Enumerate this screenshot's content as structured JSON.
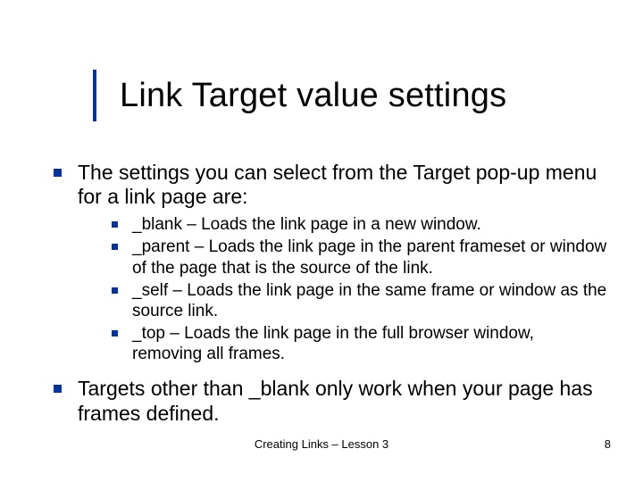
{
  "title": "Link Target value settings",
  "bullets": [
    {
      "text": "The settings you can select from the Target pop-up menu for a link page are:",
      "sub": [
        "_blank – Loads the link page in a new window.",
        "_parent – Loads the link page in the parent frameset or window of the page that is the source of the link.",
        "_self – Loads the link page in the same frame or window as the source link.",
        "_top – Loads the link page in the full browser window, removing all frames."
      ]
    },
    {
      "text": "Targets other than _blank only work when your page has frames defined.",
      "sub": []
    }
  ],
  "footer": {
    "center": "Creating Links – Lesson 3",
    "page": "8"
  }
}
